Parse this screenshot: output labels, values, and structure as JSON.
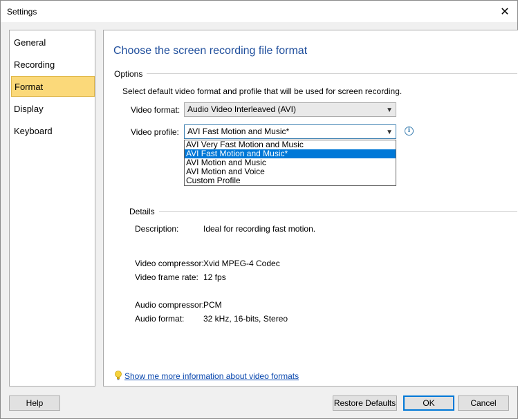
{
  "window": {
    "title": "Settings",
    "close_glyph": "✕"
  },
  "sidebar": {
    "items": [
      {
        "label": "General"
      },
      {
        "label": "Recording"
      },
      {
        "label": "Format"
      },
      {
        "label": "Display"
      },
      {
        "label": "Keyboard"
      }
    ],
    "active": "Format"
  },
  "main": {
    "heading": "Choose the screen recording file format",
    "options_group": "Options",
    "options_desc": "Select default video format and profile that will be used for screen recording.",
    "video_format_label": "Video format:",
    "video_format_value": "Audio Video Interleaved (AVI)",
    "video_profile_label": "Video profile:",
    "video_profile_value": "AVI Fast Motion and Music*",
    "profile_options": [
      "AVI Very Fast Motion and Music",
      "AVI Fast Motion and Music*",
      "AVI Motion and Music",
      "AVI Motion and Voice",
      "Custom Profile"
    ],
    "details_group": "Details",
    "details": {
      "description_label": "Description:",
      "description_value": "Ideal for recording fast motion.",
      "video_compressor_label": "Video compressor:",
      "video_compressor_value": "Xvid MPEG-4 Codec",
      "video_frame_rate_label": "Video frame rate:",
      "video_frame_rate_value": "12 fps",
      "audio_compressor_label": "Audio compressor:",
      "audio_compressor_value": "PCM",
      "audio_format_label": "Audio format:",
      "audio_format_value": "32 kHz, 16-bits, Stereo"
    },
    "more_info_link": "Show me more information about video formats"
  },
  "buttons": {
    "help": "Help",
    "restore_defaults": "Restore Defaults",
    "ok": "OK",
    "cancel": "Cancel"
  },
  "colors": {
    "heading": "#1f4e9c",
    "active_nav": "#fbd97a",
    "selection": "#0078d7"
  }
}
